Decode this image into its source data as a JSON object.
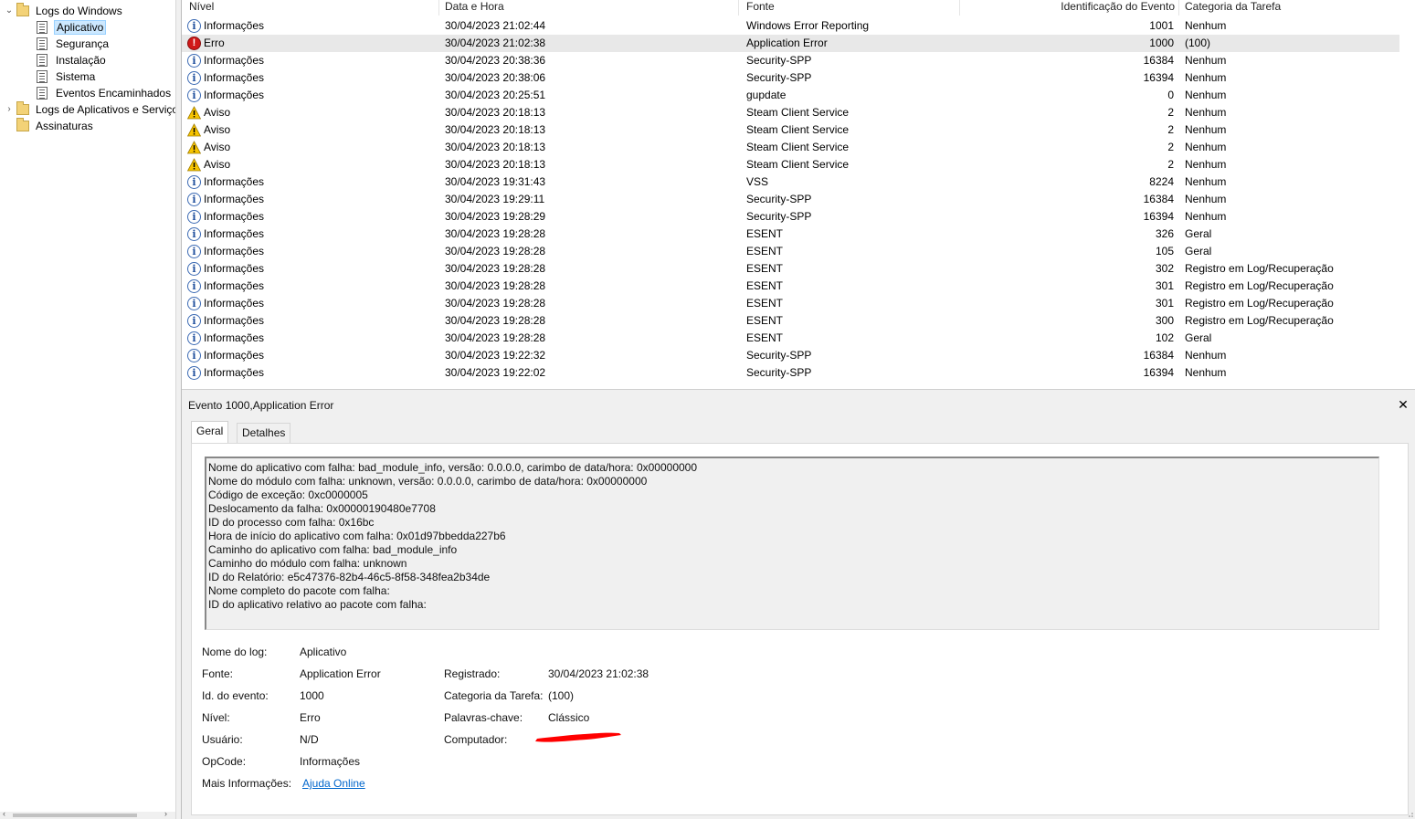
{
  "tree": {
    "items": [
      {
        "label": "Logs do Windows",
        "type": "folder",
        "twisty": "expanded"
      },
      {
        "label": "Aplicativo",
        "type": "log",
        "selected": true
      },
      {
        "label": "Segurança",
        "type": "log"
      },
      {
        "label": "Instalação",
        "type": "log"
      },
      {
        "label": "Sistema",
        "type": "log"
      },
      {
        "label": "Eventos Encaminhados",
        "type": "log"
      },
      {
        "label": "Logs de Aplicativos e Serviços",
        "type": "folder",
        "twisty": "collapsed"
      },
      {
        "label": "Assinaturas",
        "type": "folder"
      }
    ]
  },
  "list": {
    "columns": {
      "level": "Nível",
      "date": "Data e Hora",
      "source": "Fonte",
      "id": "Identificação do Evento",
      "category": "Categoria da Tarefa"
    },
    "rows": [
      {
        "icon": "info-icon",
        "level": "Informações",
        "date": "30/04/2023 21:02:44",
        "source": "Windows Error Reporting",
        "id": "1001",
        "category": "Nenhum"
      },
      {
        "icon": "error-icon",
        "level": "Erro",
        "date": "30/04/2023 21:02:38",
        "source": "Application Error",
        "id": "1000",
        "category": "(100)",
        "selected": true
      },
      {
        "icon": "info-icon",
        "level": "Informações",
        "date": "30/04/2023 20:38:36",
        "source": "Security-SPP",
        "id": "16384",
        "category": "Nenhum"
      },
      {
        "icon": "info-icon",
        "level": "Informações",
        "date": "30/04/2023 20:38:06",
        "source": "Security-SPP",
        "id": "16394",
        "category": "Nenhum"
      },
      {
        "icon": "info-icon",
        "level": "Informações",
        "date": "30/04/2023 20:25:51",
        "source": "gupdate",
        "id": "0",
        "category": "Nenhum"
      },
      {
        "icon": "warning-icon",
        "level": "Aviso",
        "date": "30/04/2023 20:18:13",
        "source": "Steam Client Service",
        "id": "2",
        "category": "Nenhum"
      },
      {
        "icon": "warning-icon",
        "level": "Aviso",
        "date": "30/04/2023 20:18:13",
        "source": "Steam Client Service",
        "id": "2",
        "category": "Nenhum"
      },
      {
        "icon": "warning-icon",
        "level": "Aviso",
        "date": "30/04/2023 20:18:13",
        "source": "Steam Client Service",
        "id": "2",
        "category": "Nenhum"
      },
      {
        "icon": "warning-icon",
        "level": "Aviso",
        "date": "30/04/2023 20:18:13",
        "source": "Steam Client Service",
        "id": "2",
        "category": "Nenhum"
      },
      {
        "icon": "info-icon",
        "level": "Informações",
        "date": "30/04/2023 19:31:43",
        "source": "VSS",
        "id": "8224",
        "category": "Nenhum"
      },
      {
        "icon": "info-icon",
        "level": "Informações",
        "date": "30/04/2023 19:29:11",
        "source": "Security-SPP",
        "id": "16384",
        "category": "Nenhum"
      },
      {
        "icon": "info-icon",
        "level": "Informações",
        "date": "30/04/2023 19:28:29",
        "source": "Security-SPP",
        "id": "16394",
        "category": "Nenhum"
      },
      {
        "icon": "info-icon",
        "level": "Informações",
        "date": "30/04/2023 19:28:28",
        "source": "ESENT",
        "id": "326",
        "category": "Geral"
      },
      {
        "icon": "info-icon",
        "level": "Informações",
        "date": "30/04/2023 19:28:28",
        "source": "ESENT",
        "id": "105",
        "category": "Geral"
      },
      {
        "icon": "info-icon",
        "level": "Informações",
        "date": "30/04/2023 19:28:28",
        "source": "ESENT",
        "id": "302",
        "category": "Registro em Log/Recuperação"
      },
      {
        "icon": "info-icon",
        "level": "Informações",
        "date": "30/04/2023 19:28:28",
        "source": "ESENT",
        "id": "301",
        "category": "Registro em Log/Recuperação"
      },
      {
        "icon": "info-icon",
        "level": "Informações",
        "date": "30/04/2023 19:28:28",
        "source": "ESENT",
        "id": "301",
        "category": "Registro em Log/Recuperação"
      },
      {
        "icon": "info-icon",
        "level": "Informações",
        "date": "30/04/2023 19:28:28",
        "source": "ESENT",
        "id": "300",
        "category": "Registro em Log/Recuperação"
      },
      {
        "icon": "info-icon",
        "level": "Informações",
        "date": "30/04/2023 19:28:28",
        "source": "ESENT",
        "id": "102",
        "category": "Geral"
      },
      {
        "icon": "info-icon",
        "level": "Informações",
        "date": "30/04/2023 19:22:32",
        "source": "Security-SPP",
        "id": "16384",
        "category": "Nenhum"
      },
      {
        "icon": "info-icon",
        "level": "Informações",
        "date": "30/04/2023 19:22:02",
        "source": "Security-SPP",
        "id": "16394",
        "category": "Nenhum"
      }
    ]
  },
  "detail": {
    "title": "Evento 1000,Application Error",
    "tabs": [
      "Geral",
      "Detalhes"
    ],
    "active_tab": "Geral",
    "description": [
      "Nome do aplicativo com falha: bad_module_info, versão: 0.0.0.0, carimbo de data/hora: 0x00000000",
      "Nome do módulo com falha: unknown, versão: 0.0.0.0, carimbo de data/hora: 0x00000000",
      "Código de exceção: 0xc0000005",
      "Deslocamento da falha: 0x00000190480e7708",
      "ID do processo com falha: 0x16bc",
      "Hora de início do aplicativo com falha: 0x01d97bbedda227b6",
      "Caminho do aplicativo com falha: bad_module_info",
      "Caminho do módulo com falha: unknown",
      "ID do Relatório: e5c47376-82b4-46c5-8f58-348fea2b34de",
      "Nome completo do pacote com falha:",
      "ID do aplicativo relativo ao pacote com falha:"
    ],
    "fields": {
      "log_name_label": "Nome do log:",
      "log_name": "Aplicativo",
      "source_label": "Fonte:",
      "source": "Application Error",
      "event_id_label": "Id. do evento:",
      "event_id": "1000",
      "level_label": "Nível:",
      "level": "Erro",
      "user_label": "Usuário:",
      "user": "N/D",
      "opcode_label": "OpCode:",
      "opcode": "Informações",
      "more_info_label": "Mais Informações:",
      "more_info_link": "Ajuda Online",
      "logged_label": "Registrado:",
      "logged": "30/04/2023 21:02:38",
      "task_category_label": "Categoria da Tarefa:",
      "task_category": "(100)",
      "keywords_label": "Palavras-chave:",
      "keywords": "Clássico",
      "computer_label": "Computador:"
    },
    "redaction_color": "#ff0000"
  }
}
